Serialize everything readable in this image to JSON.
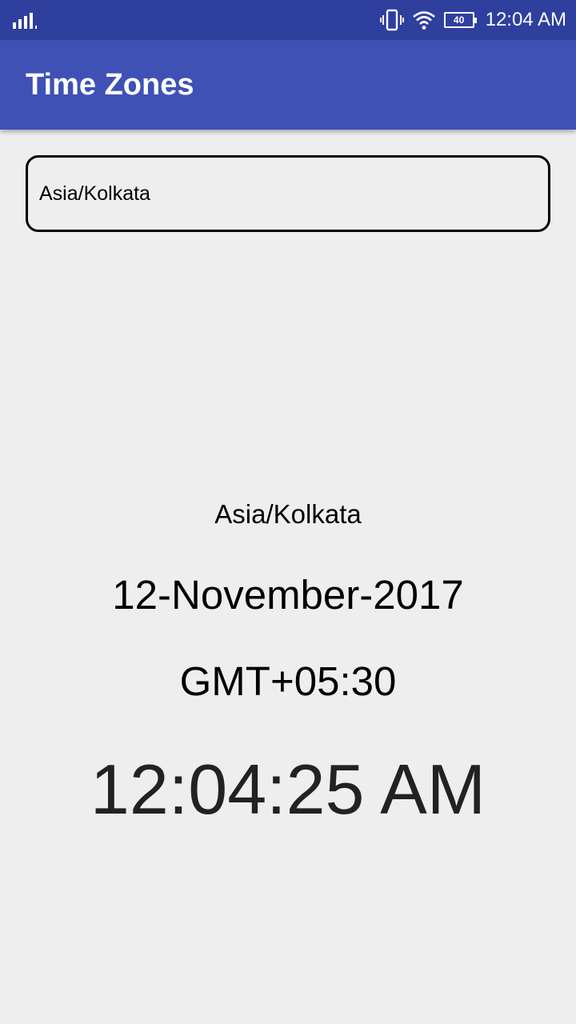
{
  "status_bar": {
    "time": "12:04 AM",
    "battery": "40",
    "icons": [
      "signal-icon",
      "vibrate-icon",
      "wifi-icon",
      "battery-icon"
    ]
  },
  "app_bar": {
    "title": "Time Zones"
  },
  "zone_field": {
    "value": "Asia/Kolkata"
  },
  "display": {
    "zone": "Asia/Kolkata",
    "date": "12-November-2017",
    "gmt_offset": "GMT+05:30",
    "time": "12:04:25 AM"
  },
  "colors": {
    "status_bar": "#2f3f9e",
    "app_bar": "#3f51b5",
    "background": "#eeeeee"
  }
}
